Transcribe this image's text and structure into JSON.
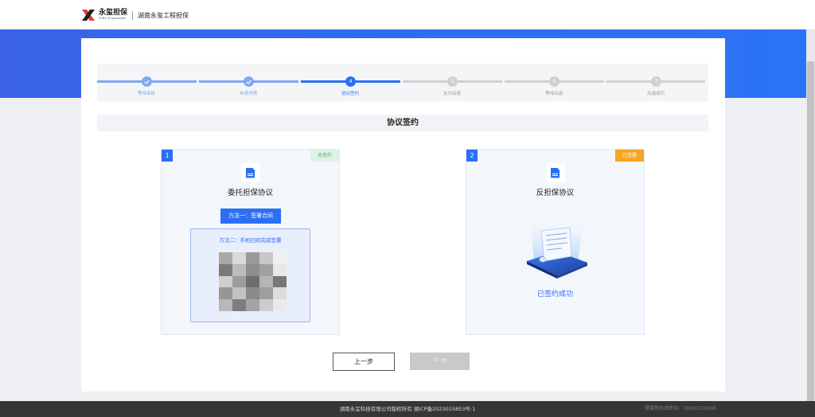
{
  "header": {
    "logo_cn": "永玺担保",
    "logo_en": "YONG XI guarantee",
    "site_name": "湖南永玺工程担保"
  },
  "steps": [
    {
      "number": "",
      "label": "等待审批",
      "state": "done"
    },
    {
      "number": "",
      "label": "申请详情",
      "state": "done"
    },
    {
      "number": "4",
      "label": "协议签约",
      "state": "active"
    },
    {
      "number": "5",
      "label": "支付出函",
      "state": "pending"
    },
    {
      "number": "6",
      "label": "等待出函",
      "state": "pending"
    },
    {
      "number": "7",
      "label": "出函成功",
      "state": "pending"
    }
  ],
  "section_title": "协议签约",
  "agreements": [
    {
      "number": "1",
      "status": "未签约",
      "title": "委托担保协议",
      "method1_label": "方法一：签署合同",
      "method2_label": "方法二：手机扫码完成签署"
    },
    {
      "number": "2",
      "status": "已签署",
      "title": "反担保协议",
      "success_text": "已签约成功"
    }
  ],
  "buttons": {
    "prev": "上一步",
    "next": "下一步"
  },
  "footer": {
    "copyright": "湖南永玺科技有限公司版权所有 湘ICP备2023015853号-1",
    "phone": "需要帮助请致电：18692220688"
  },
  "colors": {
    "primary": "#2b6ff5",
    "done_step": "#7fa7f2",
    "pending_step": "#d0d0d0",
    "signed_badge": "#f5a623",
    "unsigned_badge": "#dff3e5"
  }
}
